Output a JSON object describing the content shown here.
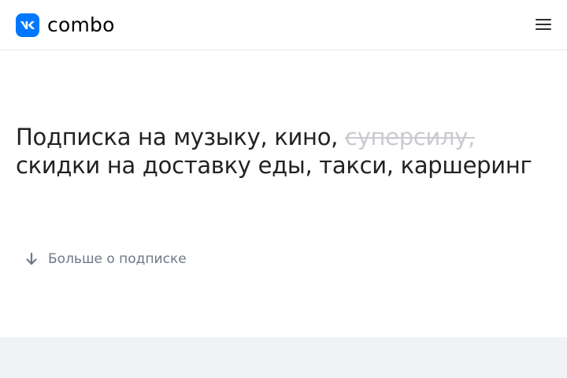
{
  "header": {
    "logo_text": "combo",
    "menu_icon": "hamburger-menu-icon"
  },
  "hero": {
    "line_part1": "Подписка на музыку, кино, ",
    "struck_text": "суперсилу,",
    "line_part2": " скидки на доставку еды, такси, каршеринг"
  },
  "more": {
    "label": "Больше о подписке",
    "icon": "arrow-down-icon"
  },
  "colors": {
    "brand_blue": "#0077ff",
    "text_primary": "#222222",
    "text_struck": "#c9cbd0",
    "text_secondary": "#6d7885",
    "band_background": "#f1f2f4"
  }
}
